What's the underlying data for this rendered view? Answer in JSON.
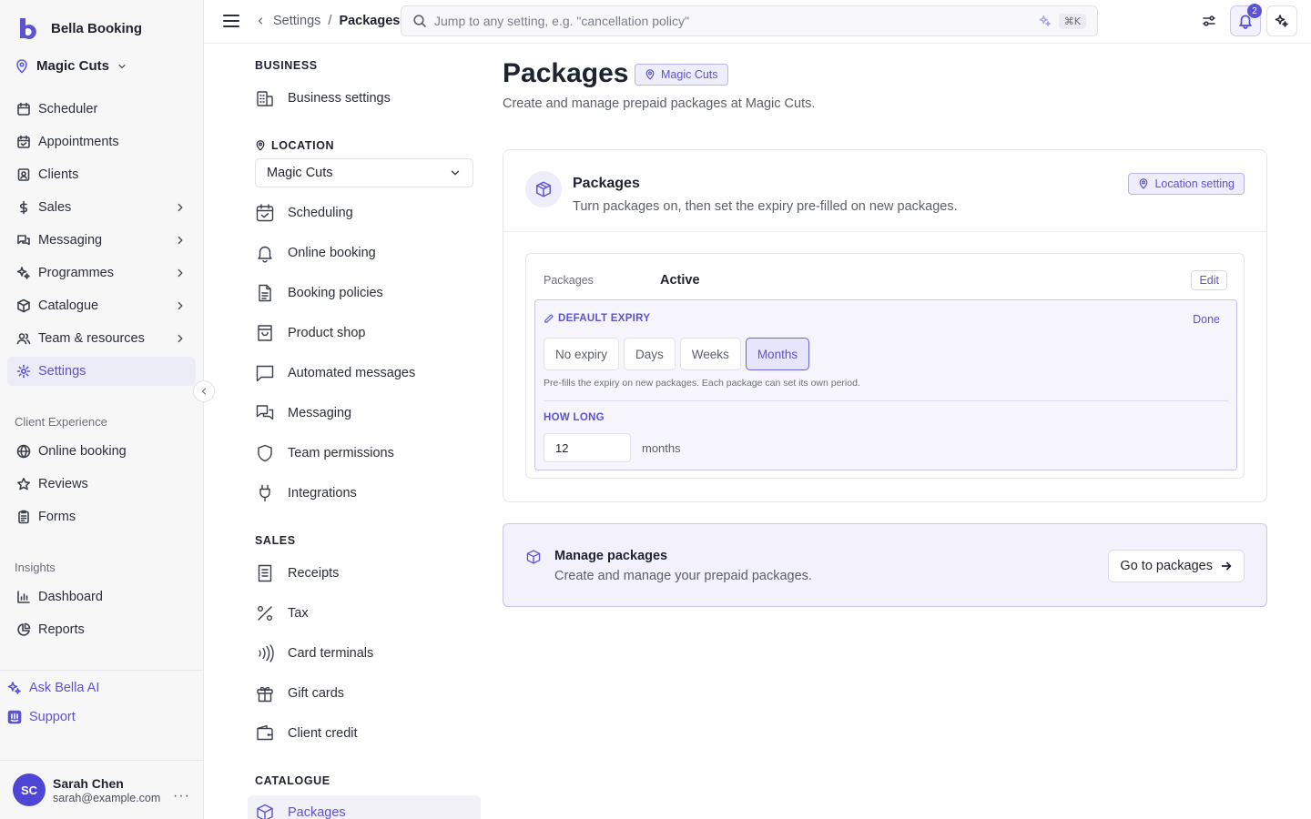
{
  "app": {
    "brand": "Bella Booking",
    "location": "Magic Cuts",
    "accent": "#5b53d6"
  },
  "sidebar": {
    "main": [
      {
        "label": "Scheduler",
        "icon": "calendar-icon",
        "chevron": false
      },
      {
        "label": "Appointments",
        "icon": "calendar-check-icon",
        "chevron": false
      },
      {
        "label": "Clients",
        "icon": "contact-icon",
        "chevron": false
      },
      {
        "label": "Sales",
        "icon": "dollar-icon",
        "chevron": true
      },
      {
        "label": "Messaging",
        "icon": "chat-icon",
        "chevron": true
      },
      {
        "label": "Programmes",
        "icon": "sparkle-icon",
        "chevron": true
      },
      {
        "label": "Catalogue",
        "icon": "box-icon",
        "chevron": true
      },
      {
        "label": "Team & resources",
        "icon": "team-icon",
        "chevron": true
      },
      {
        "label": "Settings",
        "icon": "gear-icon",
        "chevron": false,
        "active": true
      }
    ],
    "client_experience_label": "Client Experience",
    "client_experience": [
      {
        "label": "Online booking",
        "icon": "globe-icon"
      },
      {
        "label": "Reviews",
        "icon": "star-icon"
      },
      {
        "label": "Forms",
        "icon": "clipboard-icon"
      }
    ],
    "insights_label": "Insights",
    "insights": [
      {
        "label": "Dashboard",
        "icon": "bar-chart-icon"
      },
      {
        "label": "Reports",
        "icon": "pie-chart-icon"
      }
    ],
    "ask_ai": "Ask Bella AI",
    "support": "Support",
    "user": {
      "initials": "SC",
      "name": "Sarah Chen",
      "email": "sarah@example.com"
    }
  },
  "topbar": {
    "crumb_parent": "Settings",
    "crumb_sep": "/",
    "crumb_current": "Packages",
    "search_placeholder": "Jump to any setting, e.g. \"cancellation policy\"",
    "shortcut": "⌘K",
    "notifications": "2"
  },
  "settings_nav": {
    "business_head": "BUSINESS",
    "business": [
      {
        "label": "Business settings",
        "icon": "building-icon"
      }
    ],
    "location_head": "LOCATION",
    "location_value": "Magic Cuts",
    "location_items": [
      {
        "label": "Scheduling",
        "icon": "calendar-check-icon"
      },
      {
        "label": "Online booking",
        "icon": "bell-icon"
      },
      {
        "label": "Booking policies",
        "icon": "document-icon"
      },
      {
        "label": "Product shop",
        "icon": "shopping-bag-icon"
      },
      {
        "label": "Automated messages",
        "icon": "message-square-icon"
      },
      {
        "label": "Messaging",
        "icon": "chat-icon"
      },
      {
        "label": "Team permissions",
        "icon": "shield-icon"
      },
      {
        "label": "Integrations",
        "icon": "plug-icon"
      }
    ],
    "sales_head": "SALES",
    "sales_items": [
      {
        "label": "Receipts",
        "icon": "receipt-icon"
      },
      {
        "label": "Tax",
        "icon": "percent-icon"
      },
      {
        "label": "Card terminals",
        "icon": "contactless-icon"
      },
      {
        "label": "Gift cards",
        "icon": "gift-icon"
      },
      {
        "label": "Client credit",
        "icon": "wallet-icon"
      }
    ],
    "catalogue_head": "CATALOGUE",
    "catalogue_items": [
      {
        "label": "Packages",
        "icon": "box-icon",
        "active": true
      }
    ]
  },
  "main": {
    "title": "Packages",
    "title_chip": "Magic Cuts",
    "subtitle": "Create and manage prepaid packages at Magic Cuts.",
    "card": {
      "title": "Packages",
      "description": "Turn packages on, then set the expiry pre-filled on new packages.",
      "chip": "Location setting",
      "row_label": "Packages",
      "row_value": "Active",
      "edit_label": "Edit",
      "expiry_label": "DEFAULT EXPIRY",
      "done_label": "Done",
      "options": [
        "No expiry",
        "Days",
        "Weeks",
        "Months"
      ],
      "selected": "Months",
      "hint": "Pre-fills the expiry on new packages. Each package can set its own period.",
      "how_long_label": "HOW LONG",
      "how_long_value": "12",
      "unit": "months"
    },
    "manage": {
      "title": "Manage packages",
      "description": "Create and manage your prepaid packages.",
      "button": "Go to packages"
    }
  }
}
